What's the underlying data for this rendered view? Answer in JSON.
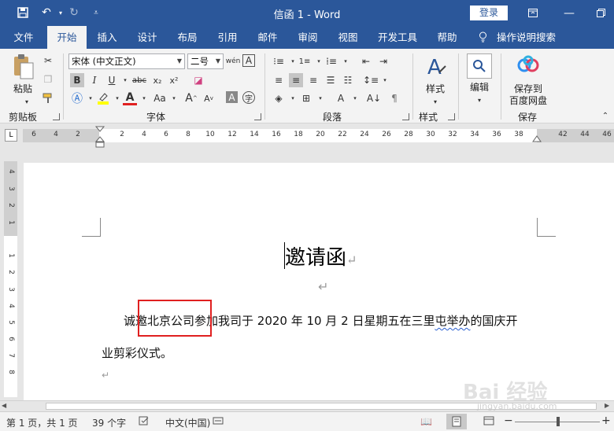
{
  "window": {
    "title": "信函 1  -  Word",
    "login_label": "登录",
    "colors": {
      "brand": "#2b579a",
      "ribbon_bg": "#f3f3f3",
      "highlight_box": "#e02020"
    }
  },
  "tabs": [
    {
      "label": "文件",
      "active": false
    },
    {
      "label": "开始",
      "active": true
    },
    {
      "label": "插入",
      "active": false
    },
    {
      "label": "设计",
      "active": false
    },
    {
      "label": "布局",
      "active": false
    },
    {
      "label": "引用",
      "active": false
    },
    {
      "label": "邮件",
      "active": false
    },
    {
      "label": "审阅",
      "active": false
    },
    {
      "label": "视图",
      "active": false
    },
    {
      "label": "开发工具",
      "active": false
    },
    {
      "label": "帮助",
      "active": false
    }
  ],
  "tell_me": "操作说明搜索",
  "ribbon": {
    "clipboard": {
      "paste_label": "粘贴",
      "group_label": "剪贴板"
    },
    "font": {
      "font_name": "宋体 (中文正文)",
      "font_size": "二号",
      "group_label": "字体"
    },
    "paragraph": {
      "group_label": "段落"
    },
    "styles": {
      "button_label": "样式",
      "group_label": "样式"
    },
    "editing": {
      "button_label": "编辑"
    },
    "save": {
      "button_label_1": "保存到",
      "button_label_2": "百度网盘",
      "group_label": "保存"
    }
  },
  "ruler": {
    "ticks": [
      "6",
      "4",
      "2",
      "",
      "2",
      "4",
      "6",
      "8",
      "10",
      "12",
      "14",
      "16",
      "18",
      "20",
      "22",
      "24",
      "26",
      "28",
      "30",
      "32",
      "34",
      "36",
      "38",
      "",
      "42",
      "44",
      "46"
    ],
    "vticks": [
      "4",
      "3",
      "2",
      "1",
      "",
      "1",
      "2",
      "3",
      "4",
      "5",
      "6",
      "7",
      "8"
    ]
  },
  "document": {
    "title": "邀请函",
    "line1_a": "诚",
    "line1_b": "邀北京公司",
    "line1_c": "参加我司于 2020 年 10 月 2 日星期五在三里",
    "line1_d": "屯举办",
    "line1_e": "的国庆开",
    "line2": "业剪彩仪式。"
  },
  "status": {
    "page": "第 1 页，共 1 页",
    "words": "39 个字",
    "language": "中文(中国)"
  },
  "watermark": {
    "text": "Bai 经验",
    "sub": "jingyan.baidu.com"
  }
}
